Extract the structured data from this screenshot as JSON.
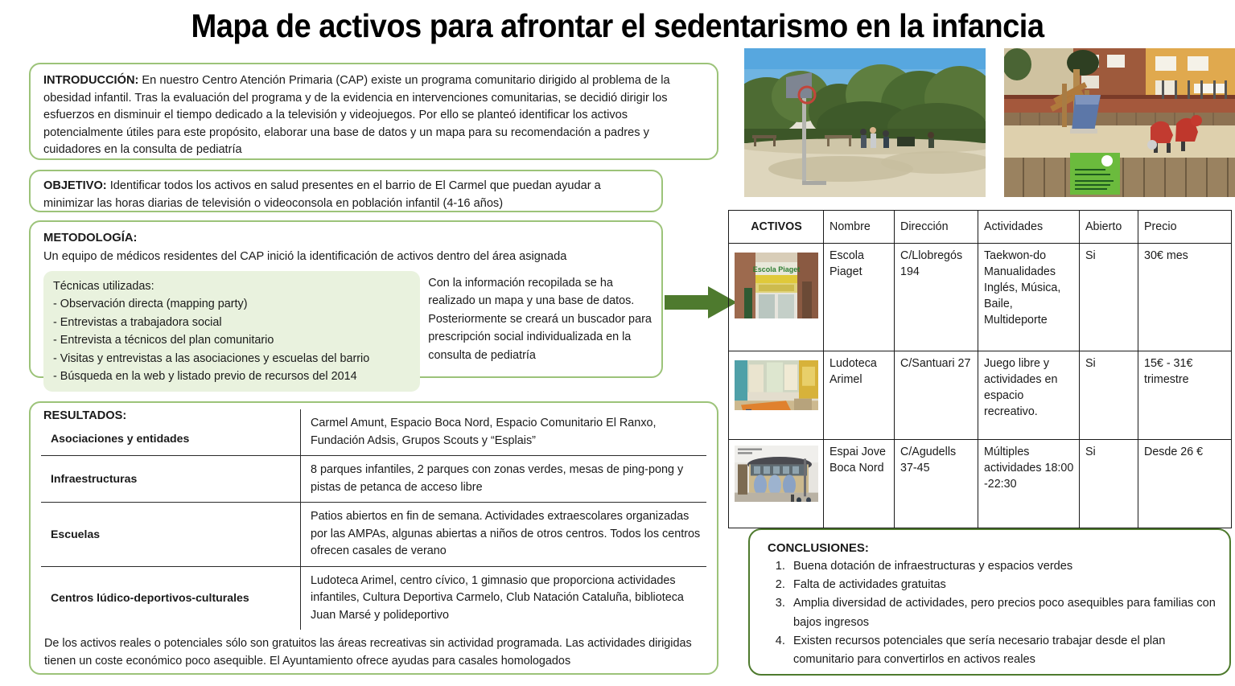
{
  "title": "Mapa de activos para afrontar el sedentarismo en la infancia",
  "intro": {
    "label": "INTRODUCCIÓN:",
    "text": " En nuestro Centro Atención Primaria (CAP) existe un programa comunitario dirigido al problema de la obesidad infantil. Tras la evaluación del programa y de la evidencia en intervenciones comunitarias, se decidió dirigir los esfuerzos en disminuir el tiempo dedicado a la televisión y videojuegos. Por ello se planteó identificar los activos potencialmente útiles para este propósito, elaborar una base de datos y un mapa para su recomendación a padres y cuidadores en la consulta de pediatría"
  },
  "objetivo": {
    "label": "OBJETIVO:",
    "text": " Identificar todos los activos en salud presentes en el barrio de El Carmel que puedan ayudar a minimizar las horas diarias de televisión o videoconsola en población infantil (4-16 años)"
  },
  "metodologia": {
    "heading": "METODOLOGÍA:",
    "subtitle": "Un equipo de médicos residentes del CAP inició la identificación de activos dentro del área asignada",
    "tecnicas_title": "Técnicas utilizadas:",
    "tecnicas": [
      "- Observación directa (mapping party)",
      "- Entrevistas a trabajadora social",
      "- Entrevista a técnicos del plan comunitario",
      "- Visitas y entrevistas a las asociaciones y escuelas del barrio",
      "- Búsqueda en la web y listado previo de recursos del 2014"
    ],
    "right_text": "Con la información recopilada se ha realizado un mapa y una base de datos. Posteriormente se creará un buscador para prescripción social individualizada en la consulta de pediatría"
  },
  "resultados": {
    "heading": "RESULTADOS:",
    "rows": [
      {
        "label": "Asociaciones y entidades",
        "value": "Carmel Amunt, Espacio Boca Nord, Espacio Comunitario El Ranxo, Fundación Adsis, Grupos Scouts y “Esplais”"
      },
      {
        "label": "Infraestructuras",
        "value": "8 parques infantiles, 2 parques con zonas verdes, mesas de ping-pong y pistas de petanca de acceso libre"
      },
      {
        "label": "Escuelas",
        "value": "Patios abiertos en fin de semana. Actividades extraescolares organizadas por las AMPAs, algunas abiertas a niños de otros centros. Todos los centros ofrecen casales de verano"
      },
      {
        "label": "Centros lúdico-deportivos-culturales",
        "value": "Ludoteca Arimel, centro cívico, 1 gimnasio que proporciona actividades infantiles, Cultura Deportiva Carmelo, Club Natación Cataluña, biblioteca Juan Marsé y polideportivo"
      }
    ],
    "footer": "De los activos reales o potenciales sólo son gratuitos las áreas recreativas sin actividad programada. Las actividades dirigidas tienen un coste económico poco asequible. El Ayuntamiento ofrece ayudas para casales homologados"
  },
  "photos": [
    {
      "name": "park-basketball-photo",
      "caption": "Parque con canasta de baloncesto"
    },
    {
      "name": "playground-photo",
      "caption": "Parque infantil con toboganes"
    }
  ],
  "arrow": {
    "name": "green-right-arrow",
    "color": "#4E7A2E"
  },
  "activos_table": {
    "headers": [
      "ACTIVOS",
      "Nombre",
      "Dirección",
      "Actividades",
      "Abierto",
      "Precio"
    ],
    "rows": [
      {
        "thumb": "escola-piaget-thumb",
        "nombre": "Escola Piaget",
        "direccion": "C/Llobregós 194",
        "actividades": "Taekwon-do Manualidades Inglés, Música, Baile, Multideporte",
        "abierto": "Si",
        "precio": "30€ mes"
      },
      {
        "thumb": "ludoteca-arimel-thumb",
        "nombre": "Ludoteca Arimel",
        "direccion": "C/Santuari 27",
        "actividades": "Juego libre y actividades en espacio recreativo.",
        "abierto": "Si",
        "precio": "15€ - 31€ trimestre"
      },
      {
        "thumb": "espai-jove-boca-nord-thumb",
        "nombre": "Espai Jove Boca Nord",
        "direccion": "C/Agudells 37-45",
        "actividades": "Múltiples actividades 18:00 -22:30",
        "abierto": "Si",
        "precio": " Desde 26 €"
      }
    ]
  },
  "conclusiones": {
    "heading": "CONCLUSIONES:",
    "items": [
      "Buena dotación de infraestructuras y espacios verdes",
      "Falta de actividades gratuitas",
      "Amplia diversidad de actividades, pero precios poco asequibles para familias con bajos ingresos",
      "Existen recursos potenciales que sería necesario trabajar desde el plan comunitario para convertirlos en activos reales"
    ]
  },
  "colors": {
    "box_border_light": "#9CC379",
    "box_border_dark": "#4E7A2E",
    "tecnicas_fill": "#E9F2DE",
    "arrow_green": "#4E7A2E",
    "table_border": "#1a1a1a"
  }
}
